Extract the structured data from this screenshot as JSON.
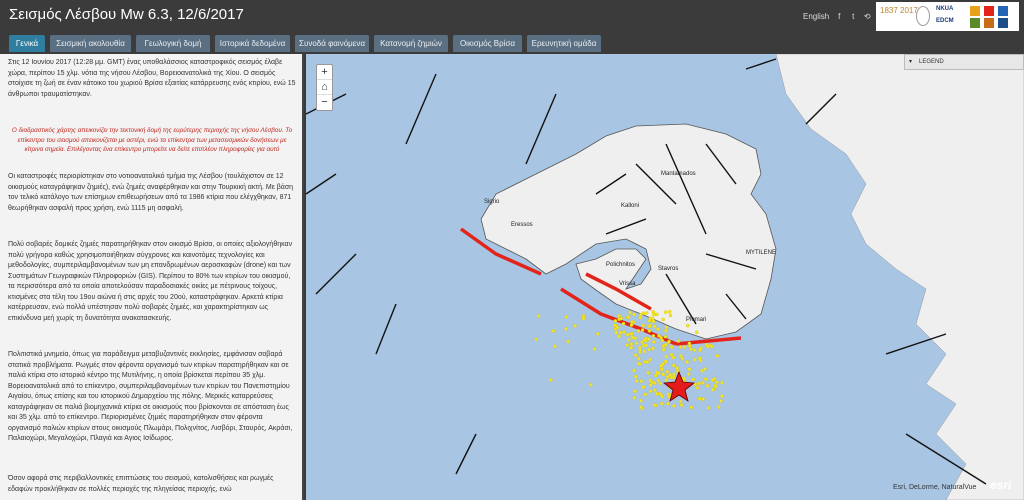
{
  "header": {
    "title": "Σεισμός Λέσβου Mw 6.3, 12/6/2017",
    "lang": "English",
    "logos": {
      "year": "1837 2017",
      "nkua": "NKUA",
      "edcm": "EDCM"
    }
  },
  "tabs": [
    {
      "label": "Γενικά"
    },
    {
      "label": "Σεισμική ακολουθία"
    },
    {
      "label": "Γεωλογική δομή"
    },
    {
      "label": "Ιστορικά δεδομένα"
    },
    {
      "label": "Συνοδά φαινόμενα"
    },
    {
      "label": "Κατανομή ζημιών"
    },
    {
      "label": "Οικισμός Βρίσα"
    },
    {
      "label": "Ερευνητική ομάδα"
    }
  ],
  "sidebar": {
    "p1": "Στις 12 Ιουνίου 2017 (12:28 μμ. GMT) ένας υποθαλάσσιος καταστροφικός σεισμός έλαβε χώρα, περίπου 15 χλμ. νότια της νήσου Λέσβου, Βορειοανατολικά της Χίου. Ο σεισμός στοίχισε τη ζωή σε έναν κάτοικο του χωριού Βρίσα εξαιτίας κατάρρευσης ενός κτιρίου, ενώ 15 άνθρωποι τραυματίστηκαν.",
    "note": "Ο διαδραστικός χάρτης απεικονίζει την τεκτονική δομή της ευρύτερης περιοχής της νήσου Λέσβου. Το επίκεντρο του σεισμού απεικονίζεται με αστέρι, ενώ τα επίκεντρα των μετασεισμικών δονήσεων με κίτρινα σημεία. Επιλέγοντας ένα επίκεντρο μπορείτε να δείτε επιπλέον πληροφορίες για αυτό",
    "p2": "Οι καταστροφές περιορίστηκαν στο νοτιοανατολικό τμήμα της Λέσβου (τουλάχιστον σε 12 οικισμούς καταγράφηκαν ζημιές), ενώ ζημιές αναφέρθηκαν και στην Τουρκική ακτή. Με βάση τον τελικό κατάλογο των επίσημων επιθεωρήσεων από τα 1986 κτίρια που ελέγχθηκαν, 871 θεωρήθηκαν ασφαλή προς χρήση, ενώ 1115 μη ασφαλή.",
    "p3": "Πολύ σοβαρές δομικές ζημιές παρατηρήθηκαν στον οικισμό Βρίσα, οι οποίες αξιολογήθηκαν πολύ γρήγορα καθώς χρησιμοποιήθηκαν σύγχρονες και καινοτόμες τεχνολογίες και μεθοδολογίες, συμπεριλαμβανομένων των μη επανδρωμένων αεροσκαφών (drone) και των Συστημάτων Γεωγραφικών Πληροφοριών (GIS). Περίπου το 80% των κτιρίων του οικισμού, τα περισσότερα από τα οποία αποτελούσαν παραδοσιακές οικίες με πέτρινους τοίχους, κτισμένες στα τέλη του 19ου αιώνα ή στις αρχές του 20ού, καταστράφηκαν. Αρκετά κτίρια κατέρρευσαν, ενώ πολλά υπέστησαν πολύ σοβαρές ζημιές, και χαρακτηρίστηκαν ως επικίνδυνα μεή χωρίς τη δυνατότητα ανακατασκευής.",
    "p4": "Πολιτιστικά μνημεία, όπως για παράδειγμα μεταβυζαντινές εκκλησίες, εμφάνισαν σοβαρά στατικά προβλήματα. Ρωγμές στον φέροντα οργανισμό των κτιρίων παρατηρήθηκαν και σε παλιά κτίρια στο ιστορικό κέντρο της Μυτιλήνης, η οποία βρίσκεται περίπου 35 χλμ. Βορειοανατολικά από το επίκεντρο, συμπεριλαμβανομένων των κτιρίων του Πανεπιστημίου Αιγαίου, όπως επίσης και του ιστορικού Δημαρχείου της πόλης. Μερικές καταρρεύσεις καταγράφηκαν σε παλιά βιομηχανικά κτίρια σε οικισμούς που βρίσκονται σε απόσταση έως και 35 χλμ. από το επίκεντρο. Περιορισμένες ζημιές παρατηρήθηκαν στον φέροντα οργανισμό παλιών κτιρίων στους οικισμούς Πλωμάρι, Πολιχνίτος, Λισβόρι, Σταυρός, Ακράσι, Παλαιοχώρι, Μεγαλοχώρι, Πλαγιά και Αγιος Ισίδωρος.",
    "p5": "Όσον αφορά στις περιβαλλοντικές επιπτώσεις του σεισμού, κατολισθήσεις και ρωγμές εδαφών προκλήθηκαν σε πολλές περιοχές της πληγείσας περιοχής, ενώ"
  },
  "map": {
    "legend_label": "LEGEND",
    "attribution": "Esri, DeLorme, NaturalVue",
    "esri": "esri",
    "places": [
      "Mantamados",
      "Sigrio",
      "Eressos",
      "Kalloni",
      "MYTILENE",
      "Polichnitos",
      "Vrissa",
      "Stavros",
      "Plomari"
    ],
    "colors": {
      "sea": "#a8c6e3",
      "land": "#efefef",
      "fault_red": "#e3241b",
      "aftershock": "#f5e52a",
      "epicenter": "#e31b1b"
    }
  }
}
